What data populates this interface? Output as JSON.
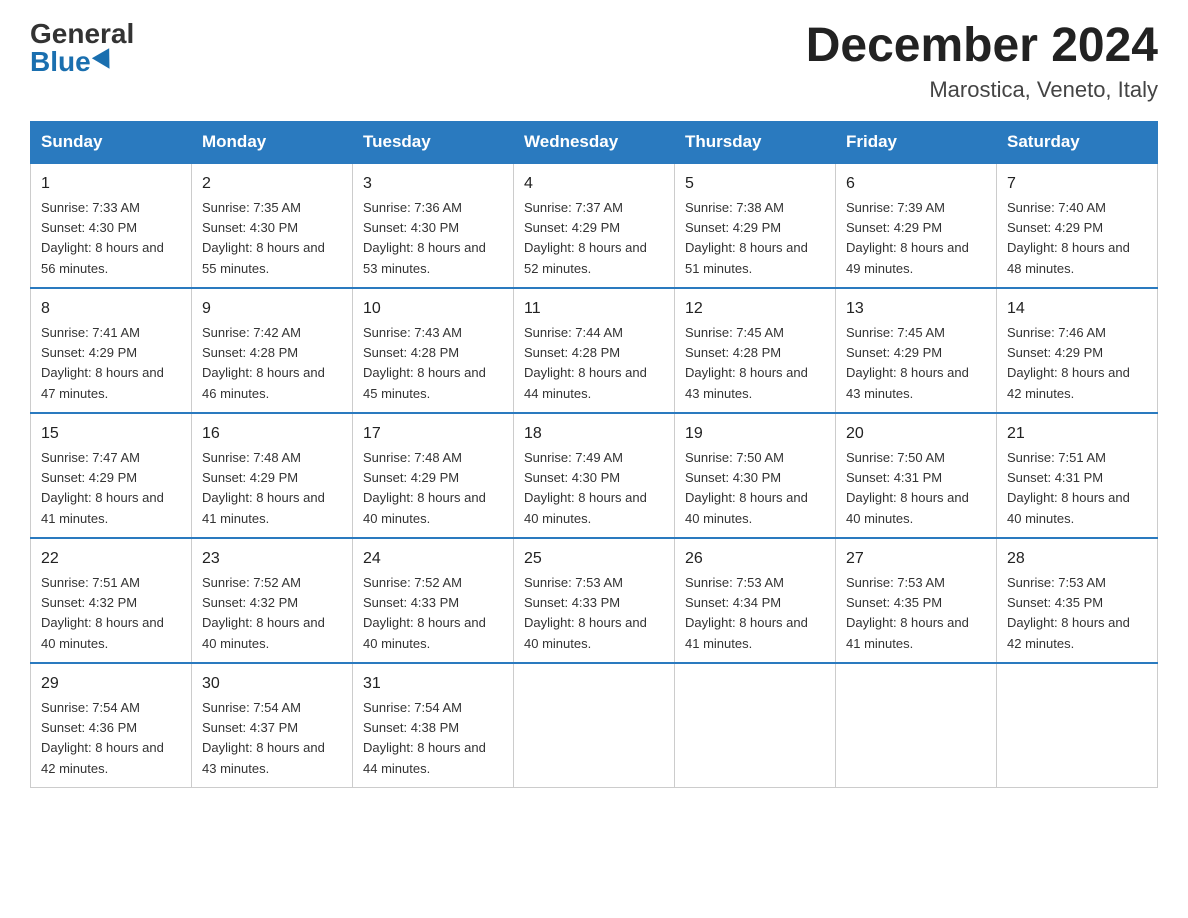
{
  "header": {
    "logo_general": "General",
    "logo_blue": "Blue",
    "month_year": "December 2024",
    "location": "Marostica, Veneto, Italy"
  },
  "days_of_week": [
    "Sunday",
    "Monday",
    "Tuesday",
    "Wednesday",
    "Thursday",
    "Friday",
    "Saturday"
  ],
  "weeks": [
    [
      {
        "day": "1",
        "sunrise": "7:33 AM",
        "sunset": "4:30 PM",
        "daylight": "8 hours and 56 minutes."
      },
      {
        "day": "2",
        "sunrise": "7:35 AM",
        "sunset": "4:30 PM",
        "daylight": "8 hours and 55 minutes."
      },
      {
        "day": "3",
        "sunrise": "7:36 AM",
        "sunset": "4:30 PM",
        "daylight": "8 hours and 53 minutes."
      },
      {
        "day": "4",
        "sunrise": "7:37 AM",
        "sunset": "4:29 PM",
        "daylight": "8 hours and 52 minutes."
      },
      {
        "day": "5",
        "sunrise": "7:38 AM",
        "sunset": "4:29 PM",
        "daylight": "8 hours and 51 minutes."
      },
      {
        "day": "6",
        "sunrise": "7:39 AM",
        "sunset": "4:29 PM",
        "daylight": "8 hours and 49 minutes."
      },
      {
        "day": "7",
        "sunrise": "7:40 AM",
        "sunset": "4:29 PM",
        "daylight": "8 hours and 48 minutes."
      }
    ],
    [
      {
        "day": "8",
        "sunrise": "7:41 AM",
        "sunset": "4:29 PM",
        "daylight": "8 hours and 47 minutes."
      },
      {
        "day": "9",
        "sunrise": "7:42 AM",
        "sunset": "4:28 PM",
        "daylight": "8 hours and 46 minutes."
      },
      {
        "day": "10",
        "sunrise": "7:43 AM",
        "sunset": "4:28 PM",
        "daylight": "8 hours and 45 minutes."
      },
      {
        "day": "11",
        "sunrise": "7:44 AM",
        "sunset": "4:28 PM",
        "daylight": "8 hours and 44 minutes."
      },
      {
        "day": "12",
        "sunrise": "7:45 AM",
        "sunset": "4:28 PM",
        "daylight": "8 hours and 43 minutes."
      },
      {
        "day": "13",
        "sunrise": "7:45 AM",
        "sunset": "4:29 PM",
        "daylight": "8 hours and 43 minutes."
      },
      {
        "day": "14",
        "sunrise": "7:46 AM",
        "sunset": "4:29 PM",
        "daylight": "8 hours and 42 minutes."
      }
    ],
    [
      {
        "day": "15",
        "sunrise": "7:47 AM",
        "sunset": "4:29 PM",
        "daylight": "8 hours and 41 minutes."
      },
      {
        "day": "16",
        "sunrise": "7:48 AM",
        "sunset": "4:29 PM",
        "daylight": "8 hours and 41 minutes."
      },
      {
        "day": "17",
        "sunrise": "7:48 AM",
        "sunset": "4:29 PM",
        "daylight": "8 hours and 40 minutes."
      },
      {
        "day": "18",
        "sunrise": "7:49 AM",
        "sunset": "4:30 PM",
        "daylight": "8 hours and 40 minutes."
      },
      {
        "day": "19",
        "sunrise": "7:50 AM",
        "sunset": "4:30 PM",
        "daylight": "8 hours and 40 minutes."
      },
      {
        "day": "20",
        "sunrise": "7:50 AM",
        "sunset": "4:31 PM",
        "daylight": "8 hours and 40 minutes."
      },
      {
        "day": "21",
        "sunrise": "7:51 AM",
        "sunset": "4:31 PM",
        "daylight": "8 hours and 40 minutes."
      }
    ],
    [
      {
        "day": "22",
        "sunrise": "7:51 AM",
        "sunset": "4:32 PM",
        "daylight": "8 hours and 40 minutes."
      },
      {
        "day": "23",
        "sunrise": "7:52 AM",
        "sunset": "4:32 PM",
        "daylight": "8 hours and 40 minutes."
      },
      {
        "day": "24",
        "sunrise": "7:52 AM",
        "sunset": "4:33 PM",
        "daylight": "8 hours and 40 minutes."
      },
      {
        "day": "25",
        "sunrise": "7:53 AM",
        "sunset": "4:33 PM",
        "daylight": "8 hours and 40 minutes."
      },
      {
        "day": "26",
        "sunrise": "7:53 AM",
        "sunset": "4:34 PM",
        "daylight": "8 hours and 41 minutes."
      },
      {
        "day": "27",
        "sunrise": "7:53 AM",
        "sunset": "4:35 PM",
        "daylight": "8 hours and 41 minutes."
      },
      {
        "day": "28",
        "sunrise": "7:53 AM",
        "sunset": "4:35 PM",
        "daylight": "8 hours and 42 minutes."
      }
    ],
    [
      {
        "day": "29",
        "sunrise": "7:54 AM",
        "sunset": "4:36 PM",
        "daylight": "8 hours and 42 minutes."
      },
      {
        "day": "30",
        "sunrise": "7:54 AM",
        "sunset": "4:37 PM",
        "daylight": "8 hours and 43 minutes."
      },
      {
        "day": "31",
        "sunrise": "7:54 AM",
        "sunset": "4:38 PM",
        "daylight": "8 hours and 44 minutes."
      },
      null,
      null,
      null,
      null
    ]
  ]
}
